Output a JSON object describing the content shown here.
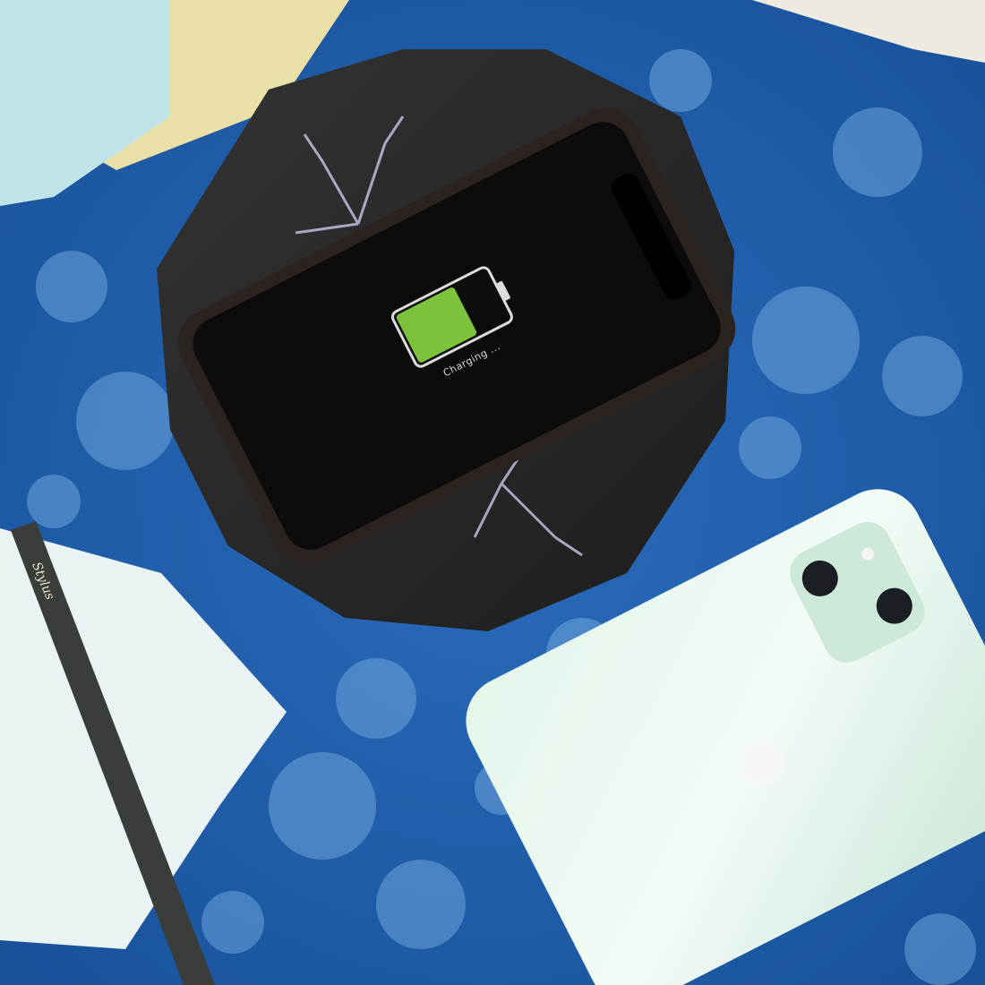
{
  "scene": {
    "description_tags": [
      "wireless-charger",
      "smartphone",
      "blue-floral-tablecloth",
      "pen",
      "notebook",
      "green-smartphone"
    ],
    "colors": {
      "tablecloth": "#1f5fae",
      "tablecloth_pattern": "#7fb3e6",
      "charger": "#2a2a2a",
      "phone_screen": "#0c0c0c",
      "battery_fill": "#7cc23a",
      "green_phone": "#d6eee0",
      "notebook": "#e9f3f3",
      "pen": "#3a3d3a",
      "paper_yellow": "#e9e0a8",
      "paper_mint": "#bfe3e6"
    }
  },
  "phone_screen": {
    "status_text": "Charging ...",
    "battery_level": 0.65
  },
  "pen": {
    "brand_text": "Stylus"
  }
}
